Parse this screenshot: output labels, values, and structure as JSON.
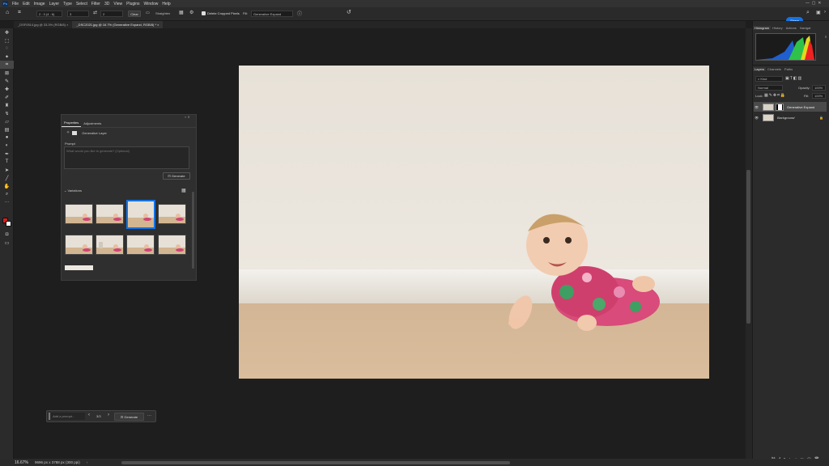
{
  "menubar": {
    "logo": "Ps",
    "items": [
      "File",
      "Edit",
      "Image",
      "Layer",
      "Type",
      "Select",
      "Filter",
      "3D",
      "View",
      "Plugins",
      "Window",
      "Help"
    ]
  },
  "options": {
    "ratio": "2 : 3 (4 : 6)",
    "w": "3",
    "h": "2",
    "clear": "Clear",
    "straighten": "Straighten",
    "delete_cropped": "Delete Cropped Pixels",
    "fill_label": "Fill:",
    "fill_value": "Generative Expand",
    "share": "Share"
  },
  "tabs": [
    {
      "label": "_DSF0514.jpg @ 33.3% (RGB/8)"
    },
    {
      "label": "_DSC2021.jpg @ 16.7% (Generative Expand, RGB/8) *"
    }
  ],
  "properties": {
    "tab1": "Properties",
    "tab2": "Adjustments",
    "layer_type": "Generative Layer",
    "prompt_label": "Prompt",
    "prompt_placeholder": "What would you like to generate? (Optional)",
    "generate": "Generate",
    "variations": "Variations"
  },
  "right": {
    "tabs": [
      "Histogram",
      "History",
      "Actions",
      "Navigat"
    ],
    "layer_tabs": [
      "Layers",
      "Channels",
      "Paths"
    ],
    "kind": "Kind",
    "mode": "Normal",
    "opacity_label": "Opacity:",
    "opacity": "100%",
    "lock_label": "Lock:",
    "fill_label": "Fill:",
    "fill": "100%",
    "layers": [
      {
        "name": "Generative Expand"
      },
      {
        "name": "Background"
      }
    ]
  },
  "ctx": {
    "placeholder": "Add a prompt...",
    "counter": "3/3",
    "generate": "Generate",
    "more": "···"
  },
  "status": {
    "zoom": "16.67%",
    "size": "9696 px x 3788 px (300 ppi)"
  },
  "icons": {
    "home": "home-icon",
    "crop": "crop-icon",
    "search": "search-icon"
  }
}
